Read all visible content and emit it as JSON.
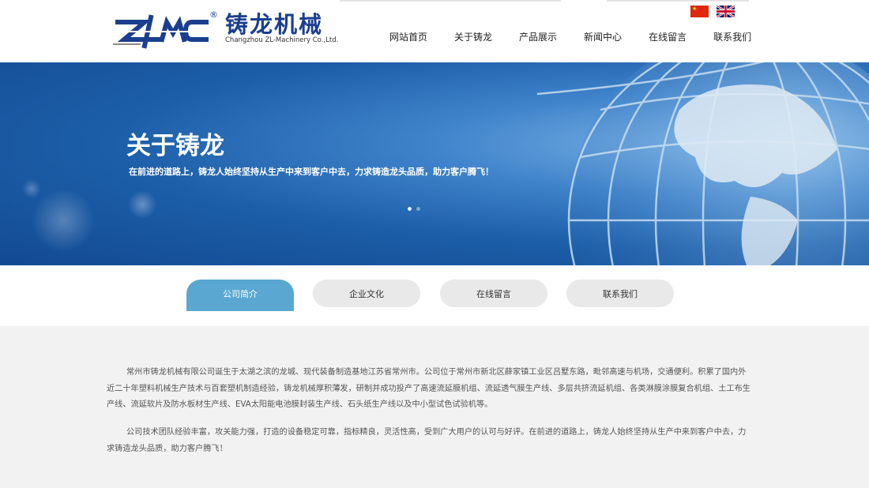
{
  "header": {
    "logo_mark_text": "ZLMC",
    "logo_reg": "®",
    "logo_cn": "铸龙机械",
    "logo_en": "Changzhou ZL-Machinery Co.,Ltd."
  },
  "nav": {
    "items": [
      "网站首页",
      "关于铸龙",
      "产品展示",
      "新闻中心",
      "在线留言",
      "联系我们"
    ]
  },
  "banner": {
    "title": "关于铸龙",
    "subtitle": "在前进的道路上，铸龙人始终坚持从生产中来到客户中去，力求铸造龙头品质，助力客户腾飞！"
  },
  "tabs": {
    "items": [
      "公司简介",
      "企业文化",
      "在线留言",
      "联系我们"
    ],
    "active_index": 0
  },
  "content": {
    "paragraphs": [
      "常州市铸龙机械有限公司诞生于太湖之滨的龙城、现代装备制造基地江苏省常州市。公司位于常州市新北区薛家镇工业区吕墅东路，毗邻高速与机场，交通便利。积累了国内外近二十年塑料机械生产技术与百套塑机制造经验，铸龙机械厚积薄发，研制并成功投产了高速流延膜机组、流延透气膜生产线、多层共挤流延机组、各类淋膜涂膜复合机组、土工布生产线、流延软片及防水板材生产线、EVA太阳能电池膜封装生产线、石头纸生产线以及中小型试色试验机等。",
      "公司技术团队经验丰富，攻关能力强，打造的设备稳定可靠，指标精良，灵活性高，受到广大用户的认可与好评。在前进的道路上，铸龙人始终坚持从生产中来到客户中去，力求铸造龙头品质，助力客户腾飞！"
    ]
  },
  "colors": {
    "brand_blue": "#1b3f8e",
    "tab_active": "#5aa8d1",
    "tab_inactive": "#e9e9e9",
    "content_bg": "#f2f2f2"
  }
}
